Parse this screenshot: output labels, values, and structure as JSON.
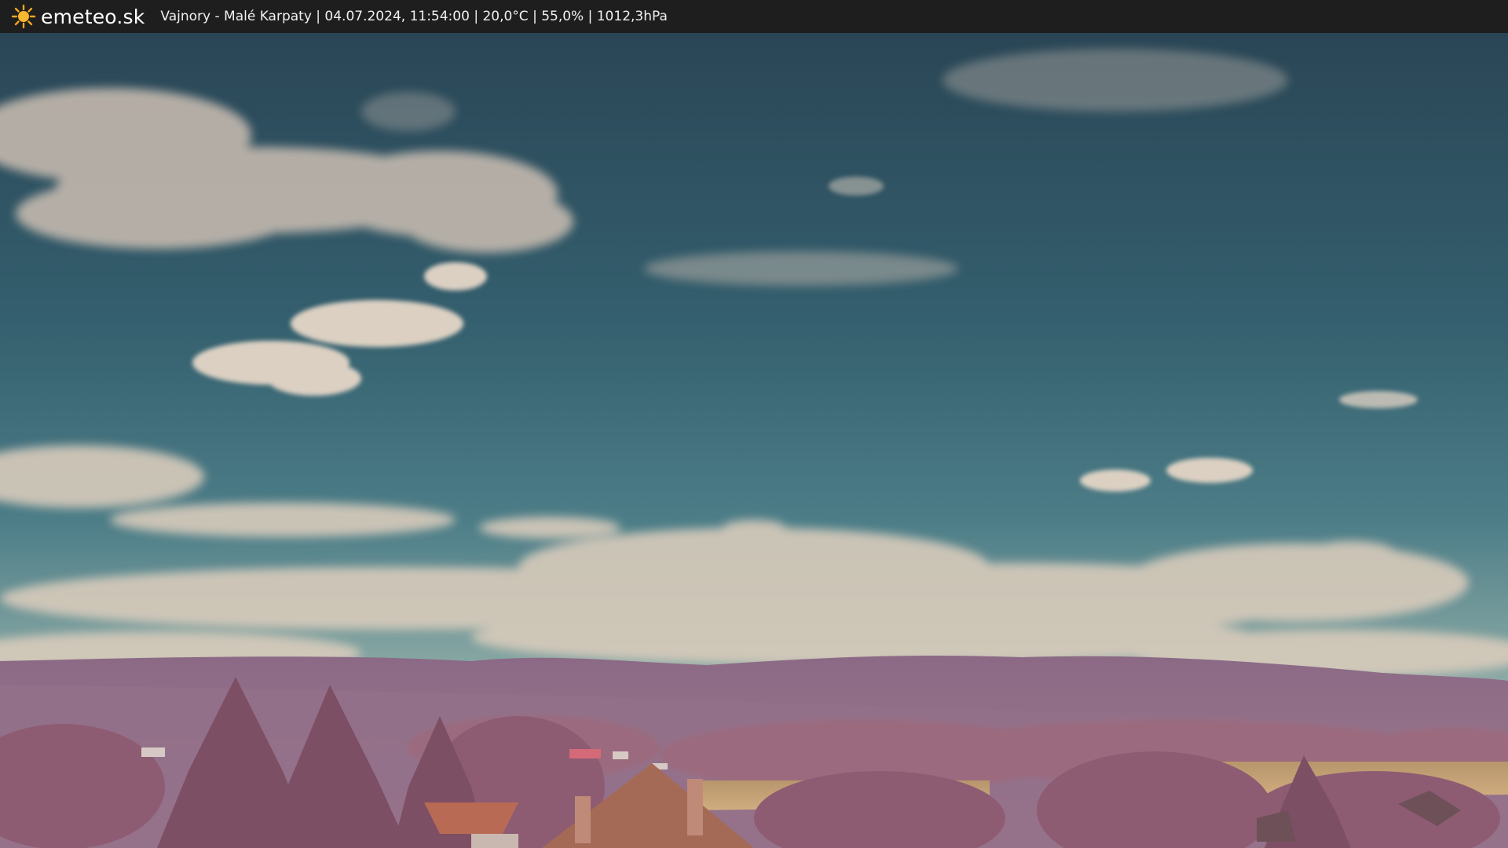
{
  "overlay": {
    "brand": "emeteo.sk",
    "caption": "Vajnory - Malé Karpaty | 04.07.2024, 11:54:00 | 20,0°C | 55,0% | 1012,3hPa",
    "logo_icon": "sun-icon",
    "logo_color": "#f5a623"
  },
  "scene": {
    "sky_top": "#2c4a5a",
    "sky_mid": "#3f6f7c",
    "sky_horizon": "#6a9aa0",
    "cloud": "#d9cdbd",
    "hills": "#8a6a82",
    "trees": "#9a6478",
    "field": "#c4a27a",
    "roof": "#b86a50"
  }
}
